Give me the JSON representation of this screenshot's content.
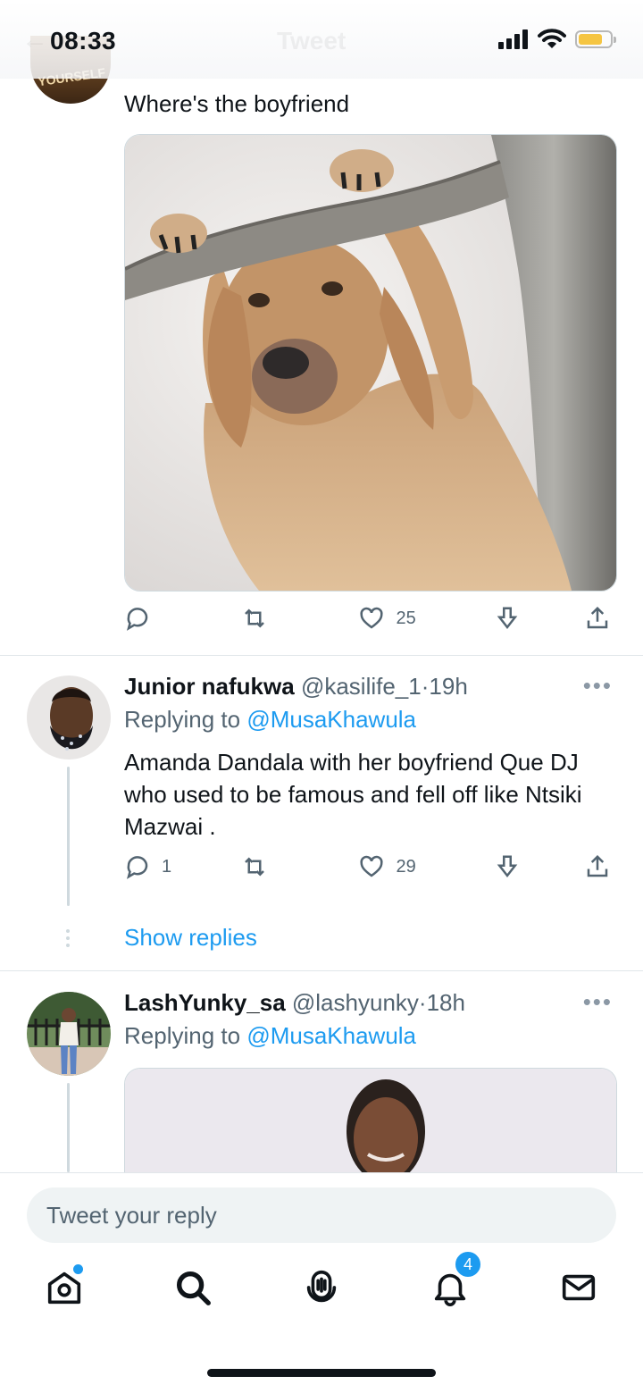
{
  "status_bar": {
    "time": "08:33",
    "ghost_title": "Tweet",
    "battery_color": "#f5c542"
  },
  "tweets": [
    {
      "text": "Where's the boyfriend",
      "avatar_text": "YOURSELF",
      "image": "dog hanging on tree branch",
      "actions": {
        "reply_count": "",
        "retweet_count": "",
        "like_count": "25"
      }
    },
    {
      "name": "Junior nafukwa",
      "handle": "@kasilife_1",
      "time": "19h",
      "replying_prefix": "Replying to",
      "replying_to": "@MusaKhawula",
      "text": "Amanda Dandala with her boyfriend Que DJ who used to be famous and fell off like Ntsiki Mazwai .",
      "actions": {
        "reply_count": "1",
        "retweet_count": "",
        "like_count": "29"
      },
      "show_replies": "Show replies"
    },
    {
      "name": "LashYunky_sa",
      "handle": "@lashyunky",
      "time": "18h",
      "replying_prefix": "Replying to",
      "replying_to": "@MusaKhawula"
    }
  ],
  "reply_box": {
    "placeholder": "Tweet your reply"
  },
  "tab_bar": {
    "items": [
      "home-icon",
      "search-icon",
      "spaces-icon",
      "notifications-icon",
      "messages-icon"
    ],
    "notifications_badge": "4"
  },
  "colors": {
    "accent": "#1d9bf0",
    "text": "#0f1419",
    "muted": "#536471"
  }
}
